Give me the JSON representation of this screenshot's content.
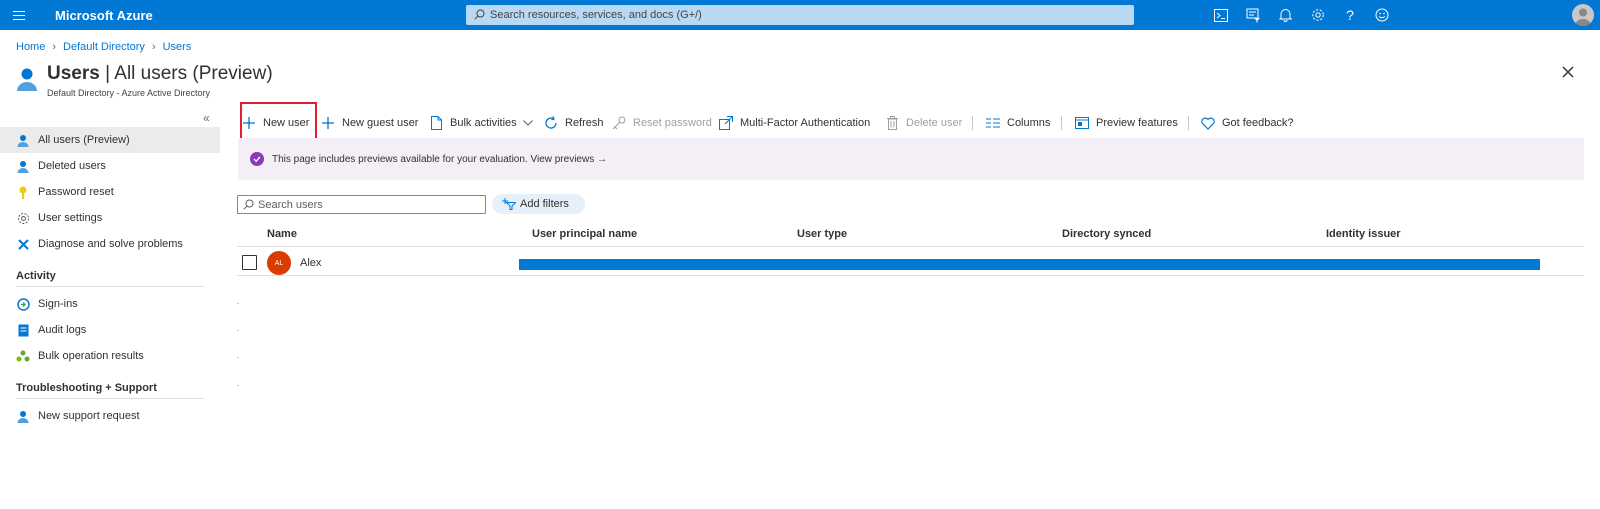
{
  "topbar": {
    "brand": "Microsoft Azure",
    "search_placeholder": "Search resources, services, and docs (G+/)",
    "icons": [
      "cloud-shell-icon",
      "directory-filter-icon",
      "notifications-icon",
      "settings-icon",
      "help-icon",
      "feedback-smiley-icon"
    ]
  },
  "breadcrumb": [
    "Home",
    "Default Directory",
    "Users"
  ],
  "header": {
    "title_bold": "Users",
    "title_rest": "| All users (Preview)",
    "subtitle": "Default Directory - Azure Active Directory"
  },
  "sidebar": {
    "collapse_glyph": "«",
    "items": [
      {
        "label": "All users (Preview)",
        "icon": "user-icon",
        "active": true
      },
      {
        "label": "Deleted users",
        "icon": "user-icon"
      },
      {
        "label": "Password reset",
        "icon": "key-icon"
      },
      {
        "label": "User settings",
        "icon": "gear-icon"
      },
      {
        "label": "Diagnose and solve problems",
        "icon": "wrench-icon"
      }
    ],
    "activity_heading": "Activity",
    "activity_items": [
      {
        "label": "Sign-ins",
        "icon": "sign-in-icon"
      },
      {
        "label": "Audit logs",
        "icon": "log-icon"
      },
      {
        "label": "Bulk operation results",
        "icon": "group-icon"
      }
    ],
    "support_heading": "Troubleshooting + Support",
    "support_items": [
      {
        "label": "New support request",
        "icon": "support-user-icon"
      }
    ]
  },
  "commands": {
    "new_user": "New user",
    "new_guest_user": "New guest user",
    "bulk_activities": "Bulk activities",
    "refresh": "Refresh",
    "reset_password": "Reset password",
    "mfa": "Multi-Factor Authentication",
    "delete_user": "Delete user",
    "columns": "Columns",
    "preview_features": "Preview features",
    "got_feedback": "Got feedback?"
  },
  "banner": {
    "text": "This page includes previews available for your evaluation. View previews →"
  },
  "filters": {
    "search_placeholder": "Search users",
    "add_filters": "Add filters"
  },
  "table": {
    "columns": [
      "Name",
      "User principal name",
      "User type",
      "Directory synced",
      "Identity issuer"
    ],
    "rows": [
      {
        "initials": "AL",
        "name": "Alex"
      }
    ]
  },
  "colors": {
    "brand_blue": "#0078d4",
    "highlight_red": "#e0202a",
    "avatar_orange": "#da3b01",
    "preview_purple": "#8a3ab5"
  }
}
